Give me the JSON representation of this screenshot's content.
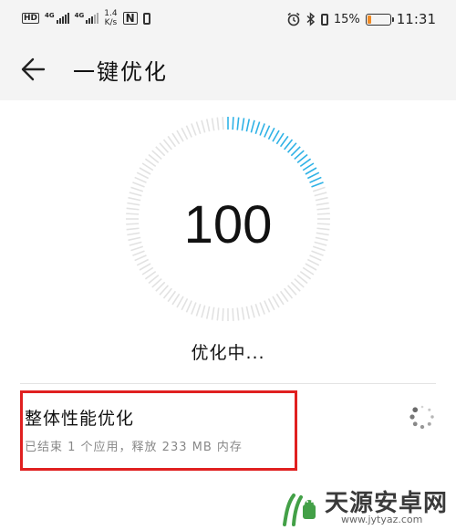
{
  "status_bar": {
    "hd_label": "HD",
    "network_1": "4G",
    "network_2": "4G",
    "speed_value": "1.4",
    "speed_unit": "K/s",
    "nfc_label": "N",
    "battery_percent": "15%",
    "battery_level": 0.15,
    "time": "11:31",
    "icons": [
      "alarm-icon",
      "bluetooth-icon",
      "vibrate-icon",
      "battery-icon"
    ]
  },
  "header": {
    "title": "一键优化",
    "back_icon": "back-arrow-icon"
  },
  "optimize": {
    "score": "100",
    "status": "优化中...",
    "progress_fraction": 0.2
  },
  "task": {
    "title": "整体性能优化",
    "subtitle": "已结束 1 个应用，释放 233 MB 内存",
    "spinner_icon": "loading-spinner-icon"
  },
  "watermark": {
    "name": "天源安卓网",
    "url": "www.jytyaz.com"
  },
  "colors": {
    "accent": "#2fb2e6",
    "dial_inactive": "#e2e2e2",
    "highlight_border": "#e02020",
    "battery_low": "#f08a24",
    "watermark_green": "#43a047"
  }
}
